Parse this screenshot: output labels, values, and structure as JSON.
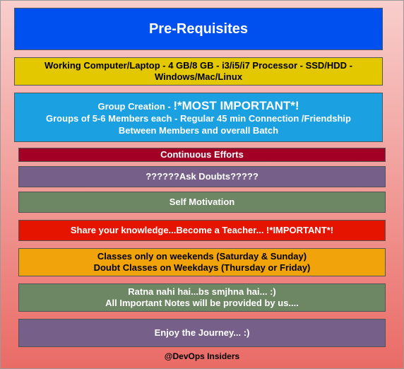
{
  "title": "Pre-Requisites",
  "boxes": [
    {
      "id": "hardware",
      "lines": [
        "Working Computer/Laptop - 4 GB/8 GB - i3/i5/i7 Processor - SSD/HDD -",
        "Windows/Mac/Linux"
      ],
      "fill": "#e3c800"
    },
    {
      "id": "group",
      "lead": "Group Creation - ",
      "emphasis": "!*MOST IMPORTANT*!",
      "lines": [
        "Groups of 5-6 Members each - Regular 45 min Connection /Friendship",
        "Between Members and overall Batch"
      ],
      "fill": "#1ba1e2"
    },
    {
      "id": "efforts",
      "lines": [
        "Continuous Efforts"
      ],
      "fill": "#a20025"
    },
    {
      "id": "doubts",
      "lines": [
        "??????Ask Doubts?????"
      ],
      "fill": "#76608a"
    },
    {
      "id": "motivation",
      "lines": [
        "Self Motivation"
      ],
      "fill": "#6d8764"
    },
    {
      "id": "share",
      "lines": [
        "Share your knowledge...Become a Teacher... !*IMPORTANT*!"
      ],
      "fill": "#e51400"
    },
    {
      "id": "classes",
      "lines": [
        "Classes only on weekends (Saturday & Sunday)",
        "Doubt Classes on Weekdays (Thursday or Friday)"
      ],
      "fill": "#f0a30a"
    },
    {
      "id": "ratna",
      "lines": [
        "Ratna nahi hai...bs smjhna hai... :)",
        "All Important Notes will be provided by us...."
      ],
      "fill": "#6d8764"
    },
    {
      "id": "journey",
      "lines": [
        "Enjoy the Journey... :)"
      ],
      "fill": "#76608a"
    }
  ],
  "footer": "@DevOps Insiders",
  "colors": {
    "title_fill": "#0050ef",
    "background_top": "#f8cecc",
    "background_bottom": "#ea6b66"
  }
}
